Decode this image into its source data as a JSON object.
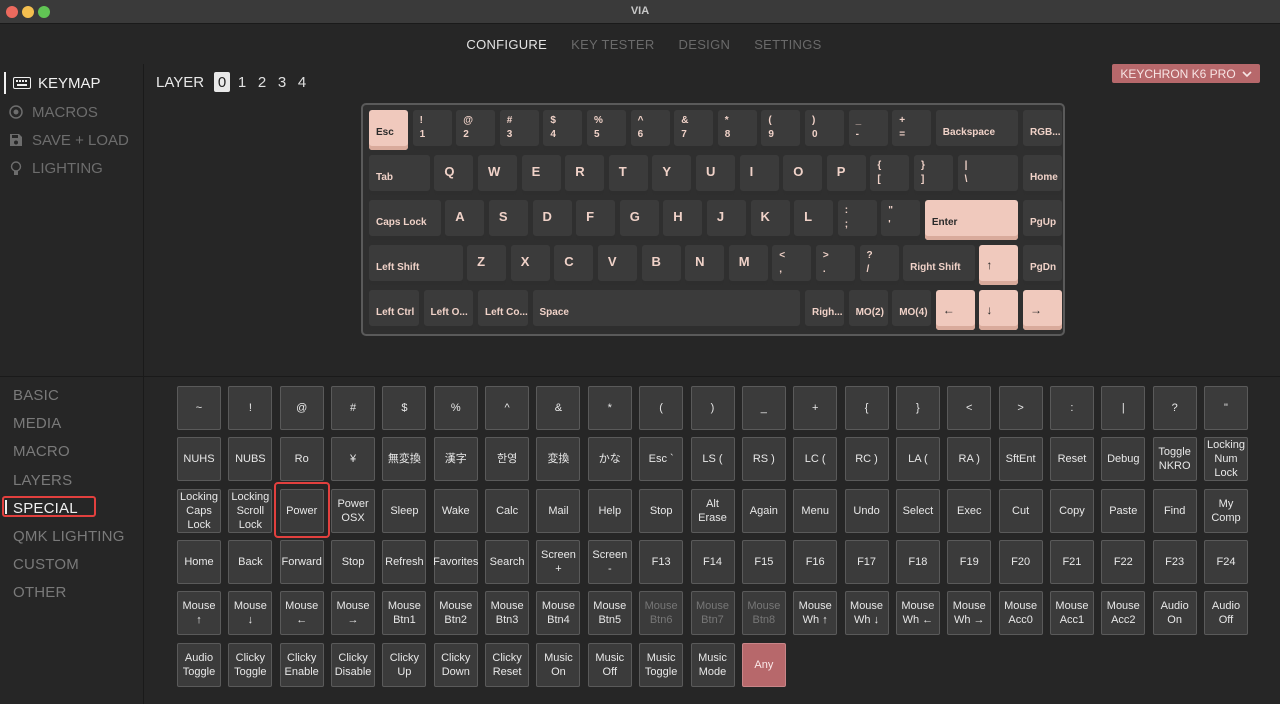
{
  "window": {
    "title": "VIA"
  },
  "nav": {
    "tabs": [
      "CONFIGURE",
      "KEY TESTER",
      "DESIGN",
      "SETTINGS"
    ],
    "active": "CONFIGURE"
  },
  "sidebar": {
    "items": [
      {
        "label": "KEYMAP",
        "icon": "keyboard-icon",
        "active": true
      },
      {
        "label": "MACROS",
        "icon": "circle-dot-icon"
      },
      {
        "label": "SAVE + LOAD",
        "icon": "floppy-icon"
      },
      {
        "label": "LIGHTING",
        "icon": "bulb-icon"
      }
    ]
  },
  "layer": {
    "label": "LAYER",
    "numbers": [
      "0",
      "1",
      "2",
      "3",
      "4"
    ],
    "active": "0"
  },
  "keyboard_select": {
    "label": "KEYCHRON K6 PRO",
    "icon": "chevron-down-icon"
  },
  "keyboard": {
    "rows": [
      [
        [
          "Esc"
        ],
        [
          "!",
          "1"
        ],
        [
          "@",
          "2"
        ],
        [
          "#",
          "3"
        ],
        [
          "$",
          "4"
        ],
        [
          "%",
          "5"
        ],
        [
          "^",
          "6"
        ],
        [
          "&",
          "7"
        ],
        [
          "*",
          "8"
        ],
        [
          "(",
          "9"
        ],
        [
          ")",
          "0"
        ],
        [
          "_",
          "-"
        ],
        [
          "+",
          "="
        ],
        [
          "Backspace"
        ],
        [
          "RGB..."
        ]
      ],
      [
        [
          "Tab"
        ],
        [
          "Q"
        ],
        [
          "W"
        ],
        [
          "E"
        ],
        [
          "R"
        ],
        [
          "T"
        ],
        [
          "Y"
        ],
        [
          "U"
        ],
        [
          "I"
        ],
        [
          "O"
        ],
        [
          "P"
        ],
        [
          "{",
          "["
        ],
        [
          "}",
          "]"
        ],
        [
          "|",
          "\\"
        ],
        [
          "Home"
        ]
      ],
      [
        [
          "Caps Lock"
        ],
        [
          "A"
        ],
        [
          "S"
        ],
        [
          "D"
        ],
        [
          "F"
        ],
        [
          "G"
        ],
        [
          "H"
        ],
        [
          "J"
        ],
        [
          "K"
        ],
        [
          "L"
        ],
        [
          ":",
          ";"
        ],
        [
          "\"",
          "'"
        ],
        [
          "Enter"
        ],
        [
          "PgUp"
        ]
      ],
      [
        [
          "Left Shift"
        ],
        [
          "Z"
        ],
        [
          "X"
        ],
        [
          "C"
        ],
        [
          "V"
        ],
        [
          "B"
        ],
        [
          "N"
        ],
        [
          "M"
        ],
        [
          "<",
          ","
        ],
        [
          ">",
          "."
        ],
        [
          "?",
          "/"
        ],
        [
          "Right Shift"
        ],
        [
          "↑"
        ],
        [
          "PgDn"
        ]
      ],
      [
        [
          "Left Ctrl"
        ],
        [
          "Left O..."
        ],
        [
          "Left Co..."
        ],
        [
          "Space"
        ],
        [
          "Righ..."
        ],
        [
          "MO(2)"
        ],
        [
          "MO(4)"
        ],
        [
          "←"
        ],
        [
          "↓"
        ],
        [
          "→"
        ]
      ]
    ]
  },
  "categories": {
    "items": [
      "BASIC",
      "MEDIA",
      "MACRO",
      "LAYERS",
      "SPECIAL",
      "QMK LIGHTING",
      "CUSTOM",
      "OTHER"
    ],
    "active": "SPECIAL"
  },
  "keycodes": {
    "rows": [
      [
        "~",
        "!",
        "@",
        "#",
        "$",
        "%",
        "^",
        "&",
        "*",
        "(",
        ")",
        "_",
        "+",
        "{",
        "}",
        "<",
        ">",
        ":",
        "|",
        "?",
        "\""
      ],
      [
        "NUHS",
        "NUBS",
        "Ro",
        "¥",
        "無変換",
        "漢字",
        "한영",
        "変換",
        "かな",
        "Esc `",
        "LS (",
        "RS )",
        "LC (",
        "RC )",
        "LA (",
        "RA )",
        "SftEnt",
        "Reset",
        "Debug",
        "Toggle NKRO",
        "Locking Num Lock"
      ],
      [
        "Locking Caps Lock",
        "Locking Scroll Lock",
        "Power",
        "Power OSX",
        "Sleep",
        "Wake",
        "Calc",
        "Mail",
        "Help",
        "Stop",
        "Alt Erase",
        "Again",
        "Menu",
        "Undo",
        "Select",
        "Exec",
        "Cut",
        "Copy",
        "Paste",
        "Find",
        "My Comp"
      ],
      [
        "Home",
        "Back",
        "Forward",
        "Stop",
        "Refresh",
        "Favorites",
        "Search",
        "Screen +",
        "Screen -",
        "F13",
        "F14",
        "F15",
        "F16",
        "F17",
        "F18",
        "F19",
        "F20",
        "F21",
        "F22",
        "F23",
        "F24"
      ],
      [
        "Mouse ↑",
        "Mouse ↓",
        "Mouse ←",
        "Mouse →",
        "Mouse Btn1",
        "Mouse Btn2",
        "Mouse Btn3",
        "Mouse Btn4",
        "Mouse Btn5",
        "Mouse Btn6",
        "Mouse Btn7",
        "Mouse Btn8",
        "Mouse Wh ↑",
        "Mouse Wh ↓",
        "Mouse Wh ←",
        "Mouse Wh →",
        "Mouse Acc0",
        "Mouse Acc1",
        "Mouse Acc2",
        "Audio On",
        "Audio Off"
      ],
      [
        "Audio Toggle",
        "Clicky Toggle",
        "Clicky Enable",
        "Clicky Disable",
        "Clicky Up",
        "Clicky Down",
        "Clicky Reset",
        "Music On",
        "Music Off",
        "Music Toggle",
        "Music Mode",
        "Any"
      ]
    ],
    "highlighted": "Power"
  },
  "colors": {
    "accent": "#b7686b",
    "keycap_highlight": "#f0c9bd",
    "highlight_box": "#e2403e"
  }
}
